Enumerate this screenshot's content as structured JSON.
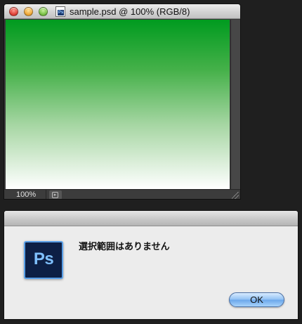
{
  "document_window": {
    "title": "sample.psd @ 100% (RGB/8)",
    "zoom_level": "100%",
    "proxy_icon": "ps-document-icon",
    "canvas_fill": {
      "type": "vertical-gradient",
      "colors": [
        "#009b1f",
        "#ffffff"
      ]
    }
  },
  "alert": {
    "app_icon_text": "Ps",
    "message": "選択範囲はありません",
    "ok_label": "OK"
  }
}
